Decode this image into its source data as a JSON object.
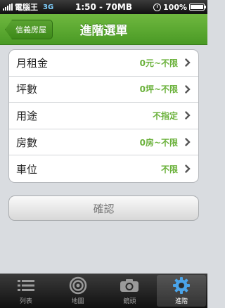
{
  "status_bar": {
    "carrier": "電腦王",
    "network": "3G",
    "time": "1:50 - 70MB",
    "battery": "100%"
  },
  "nav": {
    "back_label": "信義房屋",
    "title": "進階選單"
  },
  "options": [
    {
      "label": "月租金",
      "value": "0元~不限"
    },
    {
      "label": "坪數",
      "value": "0坪~不限"
    },
    {
      "label": "用途",
      "value": "不指定"
    },
    {
      "label": "房數",
      "value": "0房~不限"
    },
    {
      "label": "車位",
      "value": "不限"
    }
  ],
  "confirm_label": "確認",
  "tabs": [
    {
      "label": "列表",
      "icon": "list-icon"
    },
    {
      "label": "地圖",
      "icon": "map-target-icon"
    },
    {
      "label": "鏡頭",
      "icon": "camera-icon"
    },
    {
      "label": "進階",
      "icon": "gear-icon"
    }
  ],
  "colors": {
    "accent_green": "#5aa231",
    "value_green": "#6ab13a"
  }
}
